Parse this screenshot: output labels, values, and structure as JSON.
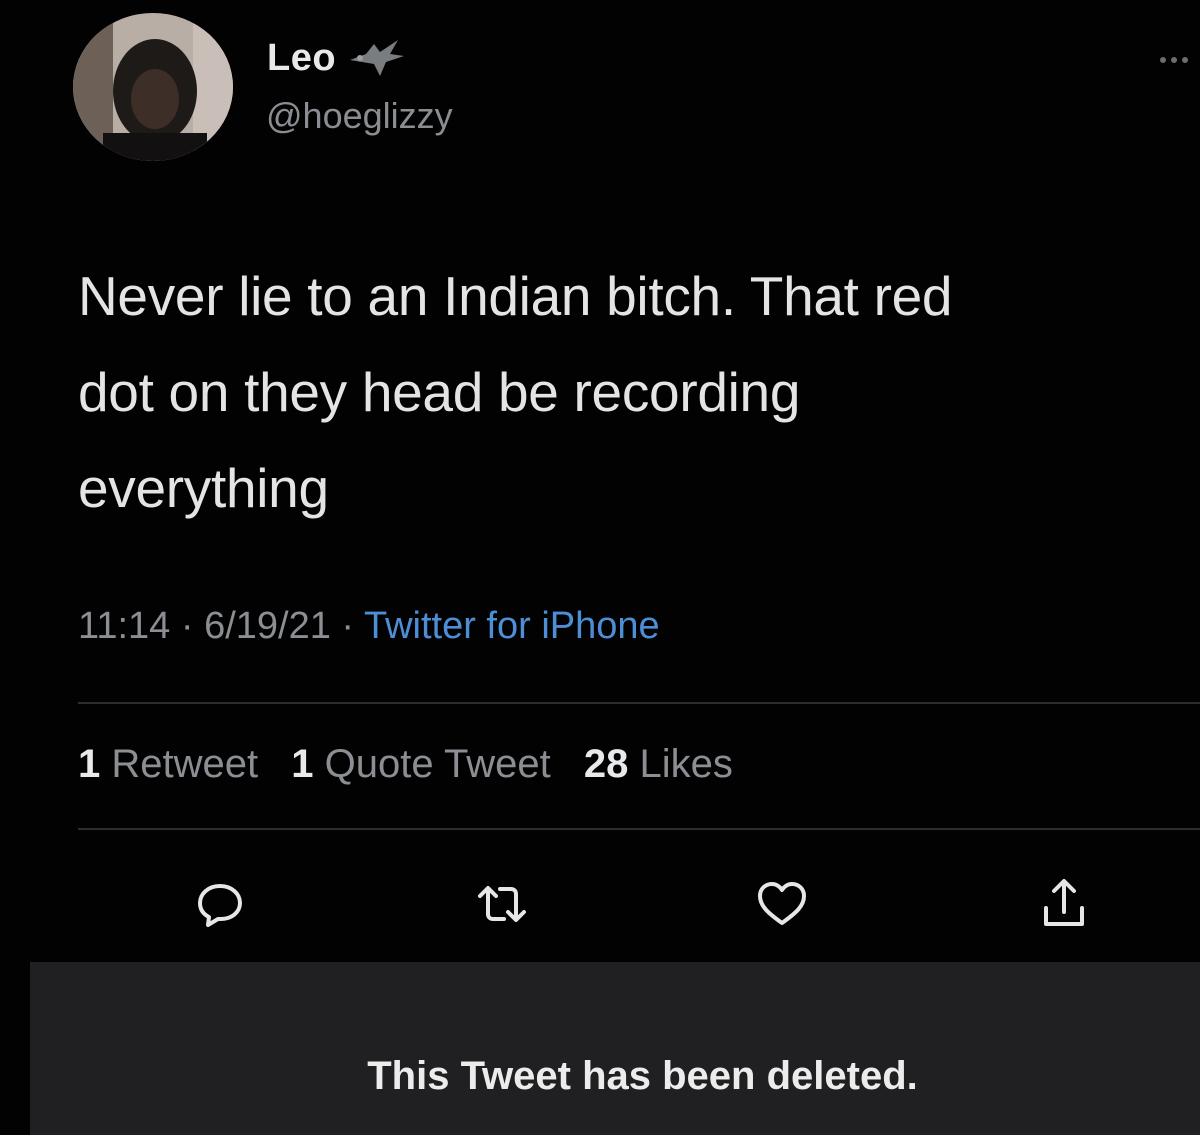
{
  "author": {
    "name": "Leo",
    "handle": "@hoeglizzy"
  },
  "tweet": {
    "text": "Never lie to an Indian bitch. That red\ndot on they head be recording\neverything",
    "time": "11:14",
    "date": "6/19/21",
    "source": "Twitter for iPhone"
  },
  "stats": {
    "retweets_count": "1",
    "retweets_label": "Retweet",
    "quotes_count": "1",
    "quotes_label": "Quote Tweet",
    "likes_count": "28",
    "likes_label": "Likes"
  },
  "actions": [
    {
      "icon": "reply-icon"
    },
    {
      "icon": "retweet-icon"
    },
    {
      "icon": "like-icon"
    },
    {
      "icon": "share-icon"
    }
  ],
  "banner": {
    "text": "This Tweet has been deleted."
  },
  "colors": {
    "background": "#020202",
    "text": "#e4e4e4",
    "muted": "#8b8e92",
    "link": "#4c8fd6",
    "banner": "#202022"
  }
}
